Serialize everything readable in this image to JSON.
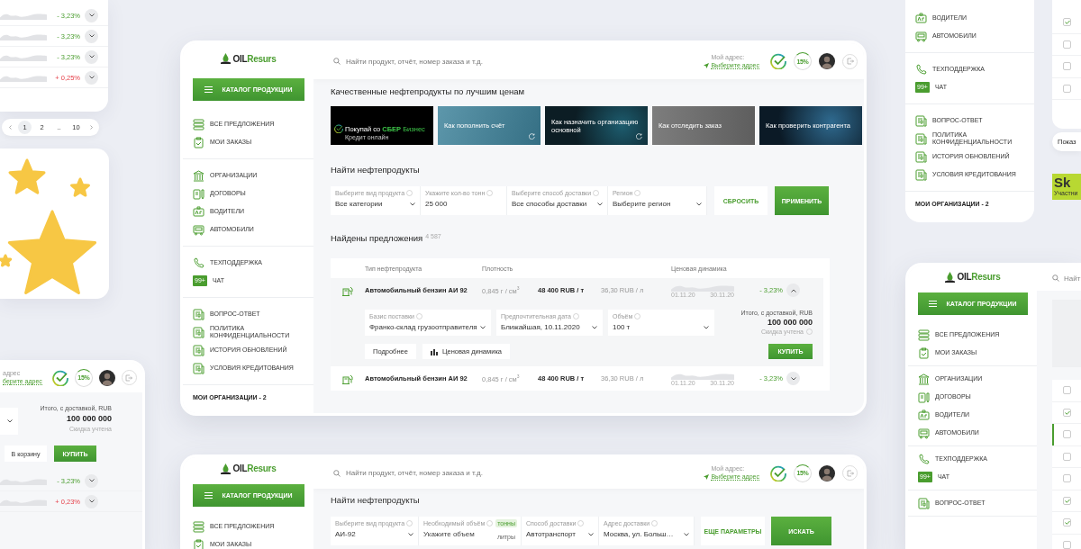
{
  "left_top_fragment": {
    "rows": [
      {
        "change": "- 3,23%",
        "kind": "down"
      },
      {
        "change": "- 3,23%",
        "kind": "down"
      },
      {
        "change": "- 3,23%",
        "kind": "down"
      },
      {
        "change": "+ 0,25%",
        "kind": "up"
      }
    ]
  },
  "pagination": {
    "pages": [
      {
        "label": "1",
        "selected": true
      },
      {
        "label": "2",
        "selected": false
      },
      {
        "label": "..",
        "selected": false
      },
      {
        "label": "10",
        "selected": false
      }
    ]
  },
  "left_bottom_fragment": {
    "address_label": "адрес",
    "address_link": "берите адрес",
    "bonus": "15%",
    "total_label": "Итого, с доставкой, RUB",
    "total": "100 000 000",
    "discount_note": "Скидка учтена",
    "cart_button": "В корзину",
    "buy_button": "КУПИТЬ",
    "rows": [
      {
        "change": "- 3,23%",
        "kind": "down"
      },
      {
        "change": "+ 0,23%",
        "kind": "up"
      }
    ]
  },
  "main_window": {
    "sidebar": {
      "logo": {
        "part_1": "OIL",
        "part_2": "Resurs"
      },
      "catalog_button": "КАТАЛОГ ПРОДУКЦИИ",
      "groups": [
        [
          {
            "label": "ВСЕ ПРЕДЛОЖЕНИЯ",
            "kind": "stack"
          },
          {
            "label": "МОИ ЗАКАЗЫ",
            "kind": "clipboard"
          }
        ],
        [
          {
            "label": "ОРГАНИЗАЦИИ",
            "kind": "building"
          },
          {
            "label": "ДОГОВОРЫ",
            "kind": "contract"
          },
          {
            "label": "ВОДИТЕЛИ",
            "kind": "id"
          },
          {
            "label": "АВТОМОБИЛИ",
            "kind": "truck"
          }
        ],
        [
          {
            "label": "ТЕХПОДДЕРЖКА",
            "kind": "phone"
          },
          {
            "label": "ЧАТ",
            "kind": "badge",
            "badge": "99+"
          }
        ],
        [
          {
            "label": "ВОПРОС-ОТВЕТ",
            "kind": "doc"
          },
          {
            "label": "ПОЛИТИКА КОНФИДЕНЦИАЛЬНОСТИ",
            "kind": "doc"
          },
          {
            "label": "ИСТОРИЯ ОБНОВЛЕНИЙ",
            "kind": "doc"
          },
          {
            "label": "УСЛОВИЯ КРЕДИТОВАНИЯ",
            "kind": "doc"
          }
        ]
      ],
      "orgs_title": "МОИ ОРГАНИЗАЦИИ - 2"
    },
    "header": {
      "search": {
        "placeholder": "Найти продукт, отчёт, номер заказа и т.д."
      },
      "address_label": "Мой адрес:",
      "address_link": "Выберите адрес",
      "bonus": "15%"
    },
    "content": {
      "promo_title": "Качественные нефтепродукты по лучшим ценам",
      "promos": [
        {
          "kind": "sber",
          "title": "Покупай со",
          "brand": "СБЕР",
          "brand_suffix": "Бизнес",
          "subtitle": "Кредит онлайн"
        },
        {
          "kind": "light",
          "title": "Как пополнить счёт"
        },
        {
          "kind": "dark",
          "title": "Как назначить организацию основной"
        },
        {
          "kind": "grey",
          "title": "Как отследить заказ"
        },
        {
          "kind": "tech",
          "title": "Как проверить контрагента"
        }
      ],
      "search_title": "Найти нефтепродукты",
      "filters": [
        {
          "label": "Выберите вид продукта",
          "value": "Все категории",
          "dropdown": true
        },
        {
          "label": "Укажите кол-во тонн",
          "value": "25 000",
          "dropdown": false
        },
        {
          "label": "Выберите способ доставки",
          "value": "Все способы доставки",
          "dropdown": true
        },
        {
          "label": "Регион",
          "value": "Выберите регион",
          "dropdown": true
        }
      ],
      "reset_button": "СБРОСИТЬ",
      "apply_button": "ПРИМЕНИТЬ",
      "results_title": "Найдены предложения",
      "results_count": "4 587",
      "columns": [
        "Тип нефтепродукта",
        "Плотность",
        "Ценовая динамика"
      ],
      "rows": [
        {
          "name": "Автомобильный бензин АИ 92",
          "density": "0,845 г / см$^{3}$",
          "price": "48 400 RUB / т",
          "price_per_litre": "36,30 RUB / л",
          "date_from": "01.11.20",
          "date_to": "30.11.20",
          "change": "- 3,23%",
          "expanded": true
        },
        {
          "name": "Автомобильный бензин АИ 92",
          "density": "0,845 г / см$^{3}$",
          "price": "48 400 RUB / т",
          "price_per_litre": "36,30 RUB / л",
          "date_from": "01.11.20",
          "date_to": "30.11.20",
          "change": "- 3,23%",
          "expanded": false
        }
      ],
      "details": {
        "fields": [
          {
            "label": "Базис поставки",
            "value": "Франко-склад грузоотправителя"
          },
          {
            "label": "Предпочтительная дата",
            "value": "Ближайшая, 10.11.2020"
          },
          {
            "label": "Объём",
            "value": "100 т"
          }
        ],
        "total_label": "Итого, с доставкой, RUB",
        "total": "100 000 000",
        "discount_note": "Скидка учтена",
        "more_button": "Подробнее",
        "dynamics_button": "Ценовая динамика",
        "buy_button": "КУПИТЬ"
      }
    }
  },
  "bottom_window": {
    "sidebar": {
      "logo": {
        "part_1": "OIL",
        "part_2": "Resurs"
      },
      "catalog_button": "КАТАЛОГ ПРОДУКЦИИ",
      "groups": [
        [
          {
            "label": "ВСЕ ПРЕДЛОЖЕНИЯ",
            "kind": "stack"
          },
          {
            "label": "МОИ ЗАКАЗЫ",
            "kind": "clipboard"
          }
        ]
      ]
    },
    "header": {
      "search": {
        "placeholder": "Найти продукт, отчёт, номер заказа и т.д."
      },
      "address_label": "Мой адрес:",
      "address_link": "Выберите адрес",
      "bonus": "15%"
    },
    "content": {
      "title": "Найти нефтепродукты",
      "filters": [
        {
          "label": "Выберите вид продукта",
          "value": "АИ-92",
          "dropdown": true
        },
        {
          "label": "Необходимый объём",
          "placeholder": "Укажите объем",
          "dropdown": false,
          "units": [
            {
              "label": "тонны",
              "selected": true
            },
            {
              "label": "литры",
              "selected": false
            }
          ]
        },
        {
          "label": "Способ доставки",
          "value": "Автотранспорт",
          "dropdown": true
        },
        {
          "label": "Адрес доставки",
          "value": "Москва, ул. Больш…",
          "dropdown": true
        }
      ],
      "more_button": "ЕЩЕ ПАРАМЕТРЫ",
      "search_button": "ИСКАТЬ"
    }
  },
  "right_top_fragment": {
    "sidebar": {
      "groups": [
        [
          {
            "label": "ВОДИТЕЛИ",
            "kind": "id"
          },
          {
            "label": "АВТОМОБИЛИ",
            "kind": "truck"
          }
        ],
        [
          {
            "label": "ТЕХПОДДЕРЖКА",
            "kind": "phone"
          },
          {
            "label": "ЧАТ",
            "kind": "badge",
            "badge": "99+"
          }
        ],
        [
          {
            "label": "ВОПРОС-ОТВЕТ",
            "kind": "doc"
          },
          {
            "label": "ПОЛИТИКА КОНФИДЕНЦИАЛЬНОСТИ",
            "kind": "doc"
          },
          {
            "label": "ИСТОРИЯ ОБНОВЛЕНИЙ",
            "kind": "doc"
          },
          {
            "label": "УСЛОВИЯ КРЕДИТОВАНИЯ",
            "kind": "doc"
          }
        ]
      ],
      "orgs_title": "МОИ ОРГАНИЗАЦИИ - 2"
    },
    "table": {
      "rows": [
        {
          "checked": true,
          "selected": false
        },
        {
          "checked": false,
          "selected": false
        },
        {
          "checked": false,
          "selected": false
        },
        {
          "checked": false,
          "selected": false
        }
      ]
    },
    "show_button": "Показ",
    "sk_badge": {
      "mark": "Sk",
      "caption": "Участни"
    }
  },
  "right_bottom_window": {
    "sidebar": {
      "logo": {
        "part_1": "OIL",
        "part_2": "Resurs"
      },
      "catalog_button": "КАТАЛОГ ПРОДУКЦИИ",
      "groups": [
        [
          {
            "label": "ВСЕ ПРЕДЛОЖЕНИЯ",
            "kind": "stack"
          },
          {
            "label": "МОИ ЗАКАЗЫ",
            "kind": "clipboard"
          }
        ],
        [
          {
            "label": "ОРГАНИЗАЦИИ",
            "kind": "building"
          },
          {
            "label": "ДОГОВОРЫ",
            "kind": "contract"
          },
          {
            "label": "ВОДИТЕЛИ",
            "kind": "id"
          },
          {
            "label": "АВТОМОБИЛИ",
            "kind": "truck"
          }
        ],
        [
          {
            "label": "ТЕХПОДДЕРЖКА",
            "kind": "phone"
          },
          {
            "label": "ЧАТ",
            "kind": "badge",
            "badge": "99+"
          }
        ],
        [
          {
            "label": "ВОПРОС-ОТВЕТ",
            "kind": "doc"
          }
        ]
      ]
    },
    "table": {
      "search": {
        "placeholder": "Найт"
      },
      "rows": [
        {
          "checked": false,
          "selected": false
        },
        {
          "checked": true,
          "selected": false
        },
        {
          "checked": false,
          "selected": true
        },
        {
          "checked": false,
          "selected": false
        },
        {
          "checked": false,
          "selected": false
        },
        {
          "checked": true,
          "selected": false
        },
        {
          "checked": true,
          "selected": false
        },
        {
          "checked": false,
          "selected": false
        }
      ]
    }
  }
}
